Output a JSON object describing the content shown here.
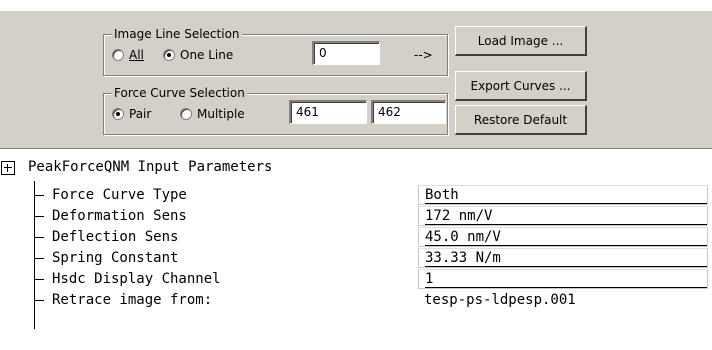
{
  "panel": {
    "image_line_group": {
      "title": "Image Line Selection",
      "options": [
        {
          "label": "All",
          "checked": false
        },
        {
          "label": "One Line",
          "checked": true
        }
      ],
      "line_value": "0",
      "arrow_text": "-->"
    },
    "force_curve_group": {
      "title": "Force Curve Selection",
      "options": [
        {
          "label": "Pair",
          "checked": true
        },
        {
          "label": "Multiple",
          "checked": false
        }
      ],
      "first_value": "461",
      "second_value": "462"
    },
    "buttons": {
      "load_image": "Load Image ...",
      "export_curves": "Export Curves ...",
      "restore_default": "Restore Default"
    }
  },
  "tree": {
    "root_label": "PeakForceQNM Input Parameters",
    "rows": [
      {
        "label": "Force Curve Type",
        "value": "Both"
      },
      {
        "label": "Deformation Sens",
        "value": "172 nm/V"
      },
      {
        "label": "Deflection Sens",
        "value": "45.0 nm/V"
      },
      {
        "label": "Spring Constant",
        "value": "33.33 N/m"
      },
      {
        "label": "Hsdc Display Channel",
        "value": "1"
      },
      {
        "label": "Retrace image from:",
        "value": "tesp-ps-ldpesp.001"
      }
    ]
  }
}
